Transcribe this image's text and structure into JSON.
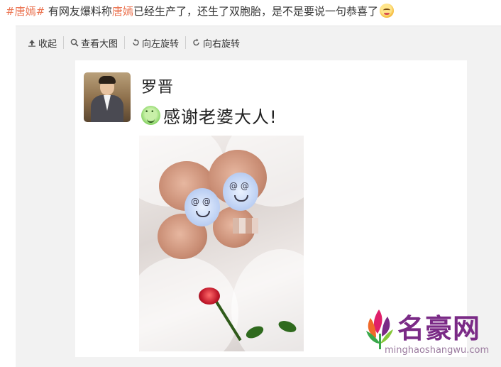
{
  "post": {
    "hashtag_1": "#唐嫣#",
    "text_1": " 有网友爆料称",
    "mention": "唐嫣",
    "text_2": "已经生产了，还生了双胞胎，是不是要说一句恭喜了"
  },
  "toolbar": {
    "collapse_label": "收起",
    "view_large_label": "查看大图",
    "rotate_left_label": "向左旋转",
    "rotate_right_label": "向右旋转"
  },
  "image_card": {
    "author_name": "罗晋",
    "caption": "感谢老婆大人!"
  },
  "watermark": {
    "title": "名豪网",
    "url": "minghaoshangwu.com"
  },
  "colors": {
    "link": "#eb7350",
    "panel_bg": "#f2f2f2",
    "watermark_purple": "#7a2a86"
  }
}
